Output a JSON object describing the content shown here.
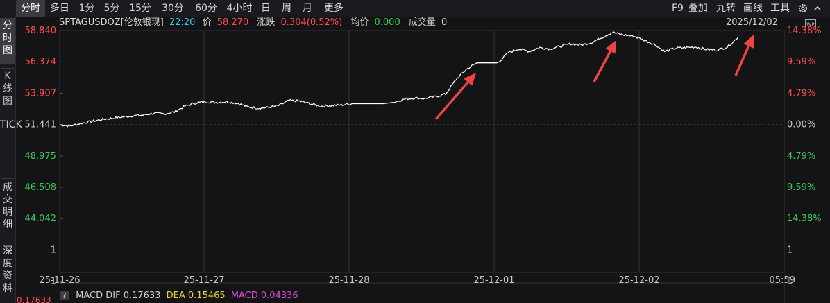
{
  "toolbar": {
    "periods": [
      "分时",
      "多日",
      "1分",
      "5分",
      "15分",
      "30分",
      "60分",
      "4小时",
      "日",
      "周",
      "月",
      "更多"
    ],
    "right": [
      "F9",
      "叠加",
      "九转",
      "画线",
      "工具"
    ]
  },
  "sidebar": {
    "tabs": [
      {
        "label": "分时图"
      },
      {
        "label": "K线图"
      },
      {
        "label": "TICK"
      },
      {
        "label": "成交明细"
      },
      {
        "label": "深度资料"
      }
    ]
  },
  "info": {
    "symbol": "SPTAGUSDOZ[伦敦银现]",
    "time": "22:20",
    "price_label": "价",
    "price": "58.270",
    "change_label": "涨跌",
    "change": "0.304(0.52%)",
    "avg_label": "均价",
    "avg": "0.000",
    "volume_label": "成交量",
    "volume": "0",
    "date": "2025/12/02"
  },
  "macd": {
    "help": "?",
    "dif_label": "MACD DIF",
    "dif": "0.17633",
    "dea_label": "DEA",
    "dea": "0.15465",
    "macd_label": "MACD",
    "macd": "0.04336",
    "left_value": "0.17633"
  },
  "colors": {
    "up": "#ff4d4d",
    "down": "#33cc55",
    "neutral": "#c8c8c8",
    "time": "#3cc8e8",
    "line": "#ffffff",
    "arrow": "#f04444",
    "dea": "#e6d23c",
    "macd": "#d84cd8"
  },
  "icons": {
    "settings": "gear-icon",
    "download": "wp-icon"
  },
  "chart_data": {
    "type": "line",
    "y_left_ticks": [
      "58.840",
      "56.374",
      "53.907",
      "51.441",
      "48.975",
      "46.508",
      "44.042",
      "1",
      "1"
    ],
    "y_right_ticks": [
      "14.38%",
      "9.59%",
      "4.79%",
      "0.00%",
      "4.79%",
      "9.59%",
      "14.38%",
      "1",
      "1"
    ],
    "x_ticks": [
      "25-11-26",
      "25-11-27",
      "25-11-28",
      "25-12-01",
      "25-12-02",
      "05:59"
    ],
    "ylim": [
      44.042,
      58.84
    ],
    "base": 51.441,
    "grid": true,
    "series": [
      {
        "values": [
          51.44,
          51.35,
          51.55,
          51.7,
          51.85,
          51.95,
          52.05,
          52.15,
          52.2,
          52.35,
          52.3,
          52.45,
          52.9,
          53.15,
          53.25,
          53.2,
          53.25,
          53.15,
          52.85,
          52.75,
          52.8,
          52.95,
          53.35,
          53.3,
          53.1,
          52.9,
          52.95,
          53.0,
          53.1,
          53.1,
          53.1,
          53.1,
          53.2,
          53.45,
          53.55,
          53.5,
          53.65,
          53.85,
          55.0,
          55.8,
          56.3,
          56.3,
          56.3,
          57.1,
          57.4,
          57.2,
          57.5,
          57.4,
          57.6,
          57.8,
          57.7,
          57.9,
          58.3,
          58.7,
          58.5,
          58.4,
          58.1,
          57.75,
          57.2,
          57.45,
          57.5,
          57.55,
          57.35,
          57.3,
          57.55,
          58.27
        ]
      }
    ],
    "annotations": {
      "arrows": 3
    }
  }
}
